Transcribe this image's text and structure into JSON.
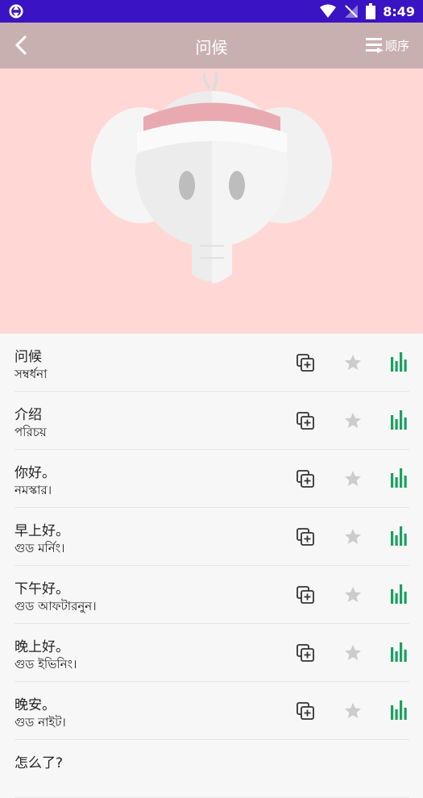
{
  "status_bar": {
    "time": "8:49",
    "icons": [
      "sync-icon",
      "wifi-icon",
      "no-signal-icon",
      "battery-icon"
    ]
  },
  "app_bar": {
    "title": "问候",
    "order_label": "顺序",
    "icons": [
      "back-arrow-icon",
      "sort-list-icon"
    ]
  },
  "hero": {
    "image": "elephant-mascot"
  },
  "colors": {
    "status_bar": "#3a13c4",
    "app_bar": "#c9b0b0",
    "hero_bg": "#ffd8d6",
    "accent_green": "#1aa060",
    "star_gray": "#cccccc"
  },
  "phrases": [
    {
      "zh": "问候",
      "bn": "সম্বর্ধনা"
    },
    {
      "zh": "介绍",
      "bn": "পরিচয়"
    },
    {
      "zh": "你好。",
      "bn": "নমস্কার।"
    },
    {
      "zh": "早上好。",
      "bn": "গুড মর্নিং।"
    },
    {
      "zh": "下午好。",
      "bn": "গুড আফটারনুন।"
    },
    {
      "zh": "晚上好。",
      "bn": "গুড ইভিনিং।"
    },
    {
      "zh": "晚安。",
      "bn": "গুড নাইট।"
    },
    {
      "zh": "怎么了?",
      "bn": ""
    }
  ]
}
